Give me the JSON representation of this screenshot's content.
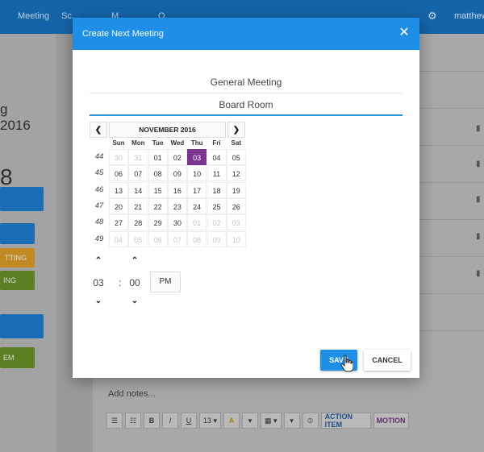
{
  "app": {
    "nav": [
      "Meeting",
      "Sc...",
      "M...",
      "O..."
    ],
    "user": "matthew",
    "icons": {
      "settings": "gear-icon"
    },
    "left_panel": {
      "line1": "g",
      "line2": "2016",
      "big": "8",
      "btn_texts": [
        "TTING",
        "ING",
        "EM"
      ]
    },
    "notes_placeholder": "Add notes...",
    "toolbar": {
      "bulleted_list": "☰",
      "numbered_list": "☷",
      "bold": "B",
      "italic": "I",
      "underline": "U",
      "font_size": "13 ▾",
      "font_color": "A",
      "color_caret": "▾",
      "table": "▦ ▾",
      "more": "▾",
      "attach": "⦶",
      "action_item": "ACTION ITEM",
      "motion": "MOTION"
    }
  },
  "modal": {
    "title": "Create Next Meeting",
    "close": "✕",
    "meeting_name": "General Meeting",
    "location": "Board Room",
    "calendar": {
      "month_label": "NOVEMBER 2016",
      "prev": "❮",
      "next": "❯",
      "weekdays": [
        "Sun",
        "Mon",
        "Tue",
        "Wed",
        "Thu",
        "Fri",
        "Sat"
      ],
      "weeks": [
        {
          "num": "44",
          "days": [
            "30",
            "31",
            "01",
            "02",
            "03",
            "04",
            "05"
          ],
          "muted": [
            true,
            true,
            false,
            false,
            false,
            false,
            false
          ]
        },
        {
          "num": "45",
          "days": [
            "06",
            "07",
            "08",
            "09",
            "10",
            "11",
            "12"
          ],
          "muted": [
            false,
            false,
            false,
            false,
            false,
            false,
            false
          ]
        },
        {
          "num": "46",
          "days": [
            "13",
            "14",
            "15",
            "16",
            "17",
            "18",
            "19"
          ],
          "muted": [
            false,
            false,
            false,
            false,
            false,
            false,
            false
          ]
        },
        {
          "num": "47",
          "days": [
            "20",
            "21",
            "22",
            "23",
            "24",
            "25",
            "26"
          ],
          "muted": [
            false,
            false,
            false,
            false,
            false,
            false,
            false
          ]
        },
        {
          "num": "48",
          "days": [
            "27",
            "28",
            "29",
            "30",
            "01",
            "02",
            "03"
          ],
          "muted": [
            false,
            false,
            false,
            false,
            true,
            true,
            true
          ]
        },
        {
          "num": "49",
          "days": [
            "04",
            "05",
            "06",
            "07",
            "08",
            "09",
            "10"
          ],
          "muted": [
            true,
            true,
            true,
            true,
            true,
            true,
            true
          ]
        }
      ],
      "selected": {
        "week": 0,
        "day": 4
      }
    },
    "time": {
      "hour": "03",
      "separator": ":",
      "minute": "00",
      "period": "PM",
      "up": "⌃",
      "down": "⌄"
    },
    "save_label": "SAVE",
    "cancel_label": "CANCEL",
    "colors": {
      "header": "#1e8fe6",
      "selected_day": "#7a3591",
      "focus_underline": "#2a93de"
    }
  }
}
